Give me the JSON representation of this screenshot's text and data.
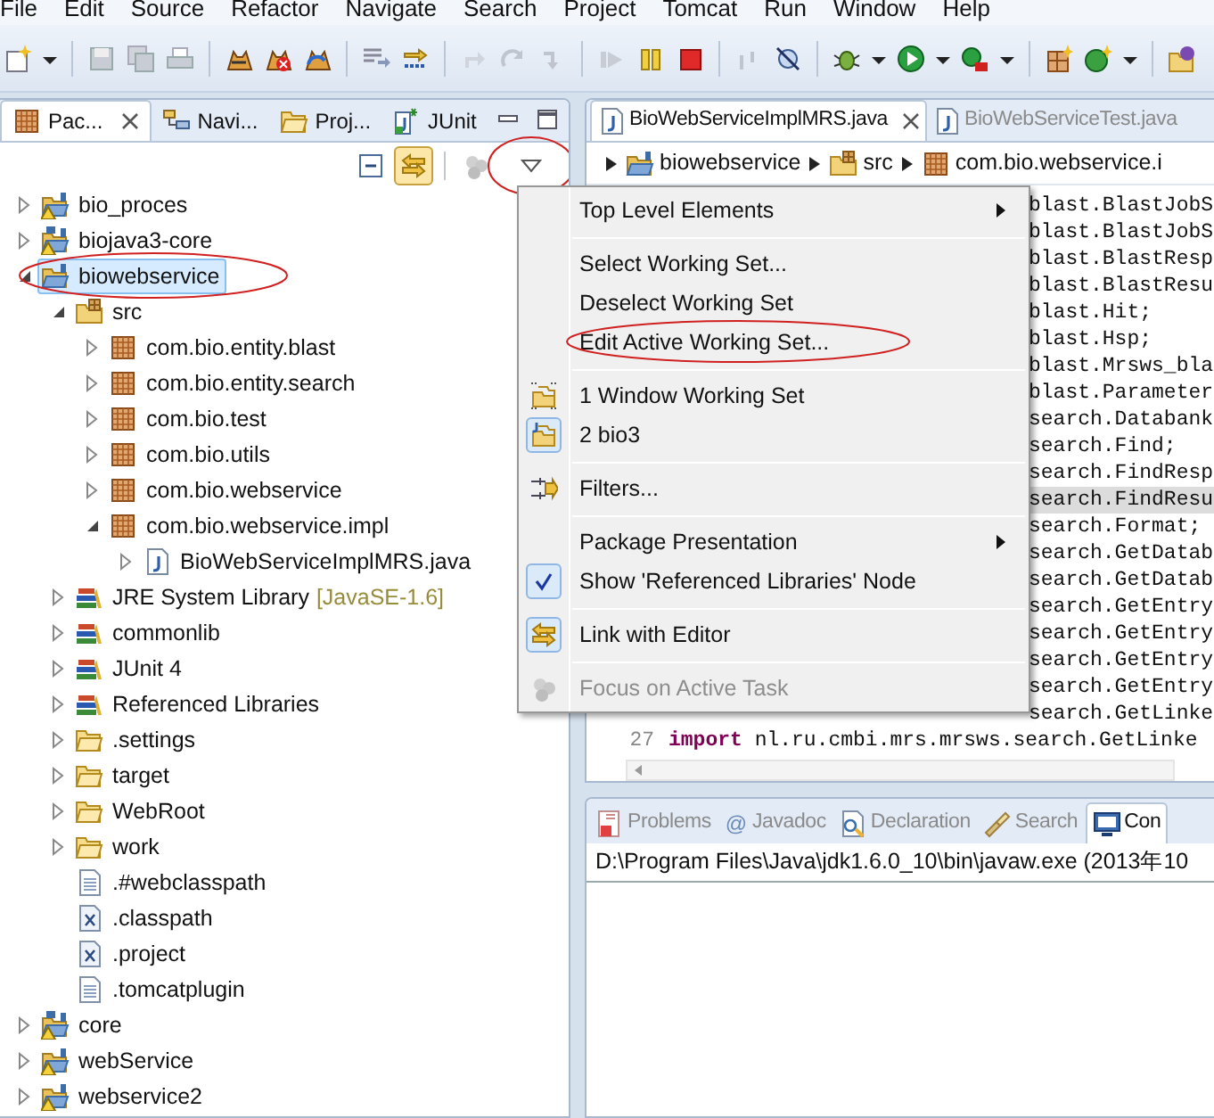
{
  "menu_bar": [
    "File",
    "Edit",
    "Source",
    "Refactor",
    "Navigate",
    "Search",
    "Project",
    "Tomcat",
    "Run",
    "Window",
    "Help"
  ],
  "package_explorer": {
    "tabs": [
      {
        "label": "Pac...",
        "selected": true
      },
      {
        "label": "Navi...",
        "selected": false
      },
      {
        "label": "Proj...",
        "selected": false
      },
      {
        "label": "JUnit",
        "selected": false
      }
    ],
    "link_with_editor": true,
    "view_menu_circled": true,
    "tree": [
      {
        "label": "bio_proces",
        "kind": "project",
        "warning": true,
        "expanded": false,
        "selected": false
      },
      {
        "label": "biojava3-core",
        "kind": "project_maven",
        "warning": true,
        "expanded": false,
        "selected": false
      },
      {
        "label": "biowebservice",
        "kind": "project",
        "warning": false,
        "expanded": true,
        "selected": true,
        "circled": true,
        "children": [
          {
            "label": "src",
            "kind": "source_folder",
            "expanded": true,
            "selected": false,
            "children": [
              {
                "label": "com.bio.entity.blast",
                "kind": "package",
                "expanded": false,
                "selected": false
              },
              {
                "label": "com.bio.entity.search",
                "kind": "package",
                "expanded": false,
                "selected": false
              },
              {
                "label": "com.bio.test",
                "kind": "package",
                "expanded": false,
                "selected": false
              },
              {
                "label": "com.bio.utils",
                "kind": "package",
                "expanded": false,
                "selected": false
              },
              {
                "label": "com.bio.webservice",
                "kind": "package",
                "expanded": false,
                "selected": false
              },
              {
                "label": "com.bio.webservice.impl",
                "kind": "package",
                "expanded": true,
                "selected": false,
                "children": [
                  {
                    "label": "BioWebServiceImplMRS.java",
                    "kind": "java_file",
                    "expanded": false,
                    "selected": false
                  }
                ]
              }
            ]
          },
          {
            "label": "JRE System Library",
            "suffix": "[JavaSE-1.6]",
            "kind": "library",
            "expanded": false,
            "selected": false
          },
          {
            "label": "commonlib",
            "kind": "library",
            "expanded": false,
            "selected": false
          },
          {
            "label": "JUnit 4",
            "kind": "library",
            "expanded": false,
            "selected": false
          },
          {
            "label": "Referenced Libraries",
            "kind": "library",
            "expanded": false,
            "selected": false
          },
          {
            "label": ".settings",
            "kind": "folder",
            "expanded": false,
            "selected": false
          },
          {
            "label": "target",
            "kind": "folder",
            "expanded": false,
            "selected": false
          },
          {
            "label": "WebRoot",
            "kind": "folder",
            "expanded": false,
            "selected": false
          },
          {
            "label": "work",
            "kind": "folder",
            "expanded": false,
            "selected": false
          },
          {
            "label": ".#webclasspath",
            "kind": "text_file",
            "selected": false
          },
          {
            "label": ".classpath",
            "kind": "xml_file",
            "selected": false
          },
          {
            "label": ".project",
            "kind": "xml_file",
            "selected": false
          },
          {
            "label": ".tomcatplugin",
            "kind": "text_file",
            "selected": false
          }
        ]
      },
      {
        "label": "core",
        "kind": "project_maven",
        "warning": true,
        "expanded": false,
        "selected": false
      },
      {
        "label": "webService",
        "kind": "project",
        "warning": true,
        "expanded": false,
        "selected": false
      },
      {
        "label": "webservice2",
        "kind": "project",
        "warning": true,
        "expanded": false,
        "selected": false
      }
    ]
  },
  "view_menu": {
    "items": [
      {
        "kind": "plain",
        "label": "Top Level Elements",
        "submenu": true,
        "checked": false,
        "disabled": false
      },
      {
        "kind": "separator"
      },
      {
        "kind": "plain",
        "label": "Select Working Set...",
        "submenu": false,
        "checked": false,
        "disabled": false
      },
      {
        "kind": "plain",
        "label": "Deselect Working Set",
        "submenu": false,
        "checked": false,
        "disabled": false
      },
      {
        "kind": "plain",
        "label": "Edit Active Working Set...",
        "submenu": false,
        "checked": false,
        "disabled": false,
        "circled": true
      },
      {
        "kind": "separator"
      },
      {
        "kind": "working_set",
        "label": "1 Window Working Set",
        "submenu": false,
        "checked": false,
        "disabled": false
      },
      {
        "kind": "java_working_set",
        "label": "2 bio3",
        "submenu": false,
        "checked": true,
        "disabled": false
      },
      {
        "kind": "separator"
      },
      {
        "kind": "filter",
        "label": "Filters...",
        "submenu": false,
        "checked": false,
        "disabled": false
      },
      {
        "kind": "separator"
      },
      {
        "kind": "plain",
        "label": "Package Presentation",
        "submenu": true,
        "checked": false,
        "disabled": false
      },
      {
        "kind": "plain",
        "label": "Show 'Referenced Libraries' Node",
        "submenu": false,
        "checked": true,
        "disabled": false
      },
      {
        "kind": "separator"
      },
      {
        "kind": "link",
        "label": "Link with Editor",
        "submenu": false,
        "checked": true,
        "disabled": false
      },
      {
        "kind": "separator"
      },
      {
        "kind": "focus",
        "label": "Focus on Active Task",
        "submenu": false,
        "checked": false,
        "disabled": true
      }
    ]
  },
  "editor": {
    "tabs": [
      {
        "label": "BioWebServiceImplMRS.java",
        "selected": true
      },
      {
        "label": "BioWebServiceTest.java",
        "selected": false
      }
    ],
    "breadcrumb": [
      {
        "label": "biowebservice",
        "kind": "project"
      },
      {
        "label": "src",
        "kind": "source_folder"
      },
      {
        "label": "com.bio.webservice.i",
        "kind": "package"
      }
    ],
    "code_fragments": [
      {
        "text": "blast.BlastJobS",
        "highlighted": false
      },
      {
        "text": "blast.BlastJobS",
        "highlighted": false
      },
      {
        "text": "blast.BlastResp",
        "highlighted": false
      },
      {
        "text": "blast.BlastResu",
        "highlighted": false
      },
      {
        "text": "blast.Hit;",
        "highlighted": false
      },
      {
        "text": "blast.Hsp;",
        "highlighted": false
      },
      {
        "text": "blast.Mrsws_bla",
        "highlighted": false
      },
      {
        "text": "blast.Parameter",
        "highlighted": false
      },
      {
        "text": "search.Databank",
        "highlighted": false
      },
      {
        "text": "search.Find;",
        "highlighted": false
      },
      {
        "text": "search.FindResp",
        "highlighted": false
      },
      {
        "text": "search.FindResu",
        "highlighted": true
      },
      {
        "text": "search.Format;",
        "highlighted": false
      },
      {
        "text": "search.GetDatab",
        "highlighted": false
      },
      {
        "text": "search.GetDatab",
        "highlighted": false
      },
      {
        "text": "search.GetEntry",
        "highlighted": false
      },
      {
        "text": "search.GetEntry",
        "highlighted": false
      },
      {
        "text": "search.GetEntry",
        "highlighted": false
      },
      {
        "text": "search.GetEntry",
        "highlighted": false
      },
      {
        "text": "search.GetLinke",
        "highlighted": false
      }
    ],
    "last_line": {
      "number": "27",
      "keyword": "import",
      "text": "nl.ru.cmbi.mrs.mrsws.search.GetLinke"
    }
  },
  "bottom_panel": {
    "tabs": [
      {
        "label": "Problems",
        "selected": false
      },
      {
        "label": "Javadoc",
        "glyph": "@",
        "selected": false
      },
      {
        "label": "Declaration",
        "selected": false
      },
      {
        "label": "Search",
        "selected": false
      },
      {
        "label": "Con",
        "selected": true
      }
    ],
    "console_text": "D:\\Program Files\\Java\\jdk1.6.0_10\\bin\\javaw.exe (2013年10"
  }
}
